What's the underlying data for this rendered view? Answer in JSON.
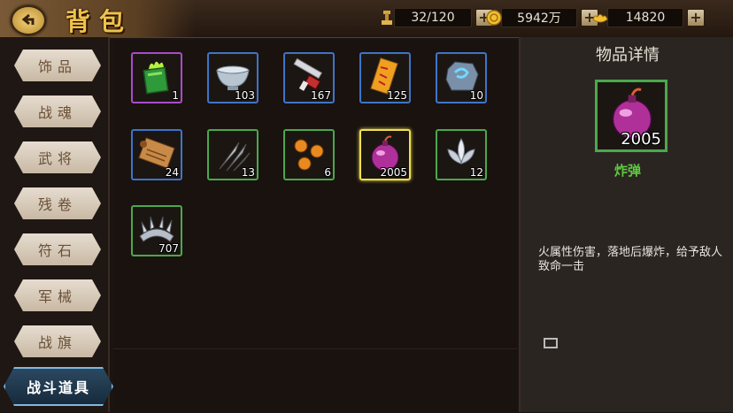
{
  "header": {
    "title": "背包",
    "resources": [
      {
        "icon": "bag-capacity-icon",
        "value": "32/120"
      },
      {
        "icon": "gold-coin-icon",
        "value": "5942万"
      },
      {
        "icon": "ingot-icon",
        "value": "14820"
      }
    ],
    "plus_label": "+"
  },
  "sidebar": {
    "tabs": [
      {
        "label": "饰品"
      },
      {
        "label": "战魂"
      },
      {
        "label": "武将"
      },
      {
        "label": "残卷"
      },
      {
        "label": "符石"
      },
      {
        "label": "军械"
      },
      {
        "label": "战旗"
      },
      {
        "label": "战斗道具",
        "active": true
      }
    ]
  },
  "inventory": {
    "items": [
      {
        "icon": "green-flame-book-icon",
        "count": "1",
        "rarity": "purple"
      },
      {
        "icon": "silver-bowl-icon",
        "count": "103",
        "rarity": "blue"
      },
      {
        "icon": "sword-whetstone-icon",
        "count": "167",
        "rarity": "blue"
      },
      {
        "icon": "talisman-paper-icon",
        "count": "125",
        "rarity": "blue"
      },
      {
        "icon": "blue-rune-stone-icon",
        "count": "10",
        "rarity": "blue"
      },
      {
        "icon": "scroll-icon",
        "count": "24",
        "rarity": "blue"
      },
      {
        "icon": "arrowheads-icon",
        "count": "13",
        "rarity": "green"
      },
      {
        "icon": "orange-orbs-icon",
        "count": "6",
        "rarity": "green"
      },
      {
        "icon": "bomb-icon",
        "count": "2005",
        "rarity": "green",
        "selected": true
      },
      {
        "icon": "silver-lotus-icon",
        "count": "12",
        "rarity": "green"
      },
      {
        "icon": "spiked-ring-icon",
        "count": "707",
        "rarity": "green"
      }
    ]
  },
  "detail": {
    "title": "物品详情",
    "item_icon": "bomb-icon",
    "item_count": "2005",
    "item_name": "炸弹",
    "item_name_color": "#5ec840",
    "description": "火属性伤害，落地后爆炸，给予敌人致命一击"
  },
  "colors": {
    "title_gold": "#f0c24a",
    "rarity_purple": "#a84cc8",
    "rarity_blue": "#3f74c8",
    "rarity_green": "#4ca84c",
    "selected_yellow": "#f0e050"
  }
}
